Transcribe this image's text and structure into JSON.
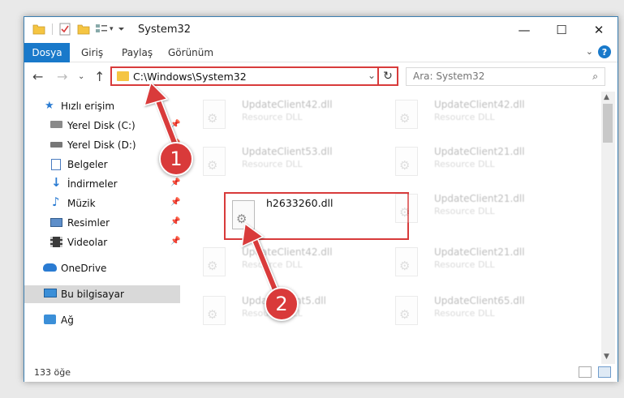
{
  "window": {
    "title": "System32",
    "minimize": "—",
    "maximize": "☐",
    "close": "✕"
  },
  "ribbon": {
    "file_tab": "Dosya",
    "tabs": [
      "Giriş",
      "Paylaş",
      "Görünüm"
    ],
    "help": "?"
  },
  "address": {
    "path": "C:\\Windows\\System32",
    "search_placeholder": "Ara: System32"
  },
  "sidebar": {
    "items": [
      {
        "label": "Hızlı erişim",
        "icon": "star-icon"
      },
      {
        "label": "Yerel Disk (C:)",
        "icon": "drive-icon"
      },
      {
        "label": "Yerel Disk (D:)",
        "icon": "drive-icon"
      },
      {
        "label": "Belgeler",
        "icon": "documents-icon"
      },
      {
        "label": "İndirmeler",
        "icon": "download-icon"
      },
      {
        "label": "Müzik",
        "icon": "music-icon"
      },
      {
        "label": "Resimler",
        "icon": "pictures-icon"
      },
      {
        "label": "Videolar",
        "icon": "videos-icon"
      },
      {
        "label": "OneDrive",
        "icon": "cloud-icon"
      },
      {
        "label": "Bu bilgisayar",
        "icon": "computer-icon"
      },
      {
        "label": "Ağ",
        "icon": "network-icon"
      }
    ]
  },
  "files": [
    {
      "name": "UpdateClient42.dll",
      "type": "Resource DLL"
    },
    {
      "name": "UpdateClient42.dll",
      "type": "Resource DLL"
    },
    {
      "name": "UpdateClient53.dll",
      "type": "Resource DLL"
    },
    {
      "name": "UpdateClient21.dll",
      "type": "Resource DLL"
    },
    {
      "name": "h2633260.dll",
      "type": ""
    },
    {
      "name": "UpdateClient21.dll",
      "type": "Resource DLL"
    },
    {
      "name": "UpdateClient42.dll",
      "type": "Resource DLL"
    },
    {
      "name": "UpdateClient21.dll",
      "type": "Resource DLL"
    },
    {
      "name": "UpdateClient5.dll",
      "type": "Resource DLL"
    },
    {
      "name": "UpdateClient65.dll",
      "type": "Resource DLL"
    }
  ],
  "status": {
    "count": "133 öğe"
  },
  "annotations": {
    "step1": "1",
    "step2": "2",
    "color": "#d93a3a"
  }
}
